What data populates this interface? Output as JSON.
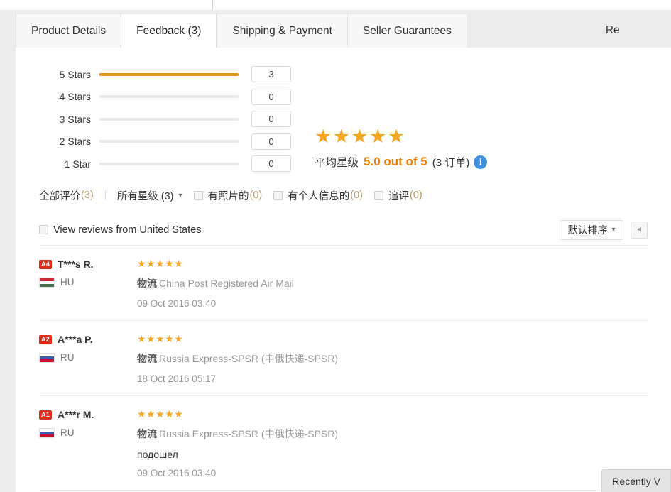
{
  "tabs": [
    {
      "label": "Product Details",
      "active": false
    },
    {
      "label": "Feedback (3)",
      "active": true
    },
    {
      "label": "Shipping & Payment",
      "active": false
    },
    {
      "label": "Seller Guarantees",
      "active": false
    },
    {
      "label": "Re",
      "active": false
    }
  ],
  "rating_summary": {
    "bars": [
      {
        "label": "5 Stars",
        "count": "3",
        "percent": 100
      },
      {
        "label": "4 Stars",
        "count": "0",
        "percent": 0
      },
      {
        "label": "3 Stars",
        "count": "0",
        "percent": 0
      },
      {
        "label": "2 Stars",
        "count": "0",
        "percent": 0
      },
      {
        "label": "1 Star",
        "count": "0",
        "percent": 0
      }
    ],
    "stars_glyph": "★★★★★",
    "avg_label": "平均星级",
    "avg_score": "5.0 out of 5",
    "orders": "(3 订单)",
    "info_glyph": "i",
    "bar_color": "#e09118",
    "star_color": "#f5a623",
    "score_color": "#e8820c",
    "info_color": "#3f8fdc"
  },
  "filters": {
    "all_reviews": "全部评价",
    "all_reviews_count": "(3)",
    "all_stars": "所有星级 (3)",
    "with_photos": "有照片的",
    "with_photos_count": "(0)",
    "with_personal": "有个人信息的",
    "with_personal_count": "(0)",
    "additional": "追评",
    "additional_count": "(0)"
  },
  "region_row": {
    "view_reviews": "View reviews from United States",
    "sort_label": "默认排序",
    "chevron": "▾",
    "pager_glyph": "◄"
  },
  "reviews": [
    {
      "badge": "A4",
      "name": "T***s R.",
      "country": "HU",
      "flag_colors": [
        "#ce2b37",
        "#ffffff",
        "#477050"
      ],
      "stars": "★★★★★",
      "logistics_label": "物流",
      "logistics": "China Post Registered Air Mail",
      "comment": "",
      "date": "09 Oct 2016 03:40"
    },
    {
      "badge": "A2",
      "name": "A***a P.",
      "country": "RU",
      "flag_colors": [
        "#ffffff",
        "#3a5fa8",
        "#c8102e"
      ],
      "stars": "★★★★★",
      "logistics_label": "物流",
      "logistics": "Russia Express-SPSR (中俄快递-SPSR)",
      "comment": "",
      "date": "18 Oct 2016 05:17"
    },
    {
      "badge": "A1",
      "name": "A***r M.",
      "country": "RU",
      "flag_colors": [
        "#ffffff",
        "#3a5fa8",
        "#c8102e"
      ],
      "stars": "★★★★★",
      "logistics_label": "物流",
      "logistics": "Russia Express-SPSR (中俄快递-SPSR)",
      "comment": "подошел",
      "date": "09 Oct 2016 03:40"
    }
  ],
  "recent_tab": {
    "label": "Recently V"
  }
}
